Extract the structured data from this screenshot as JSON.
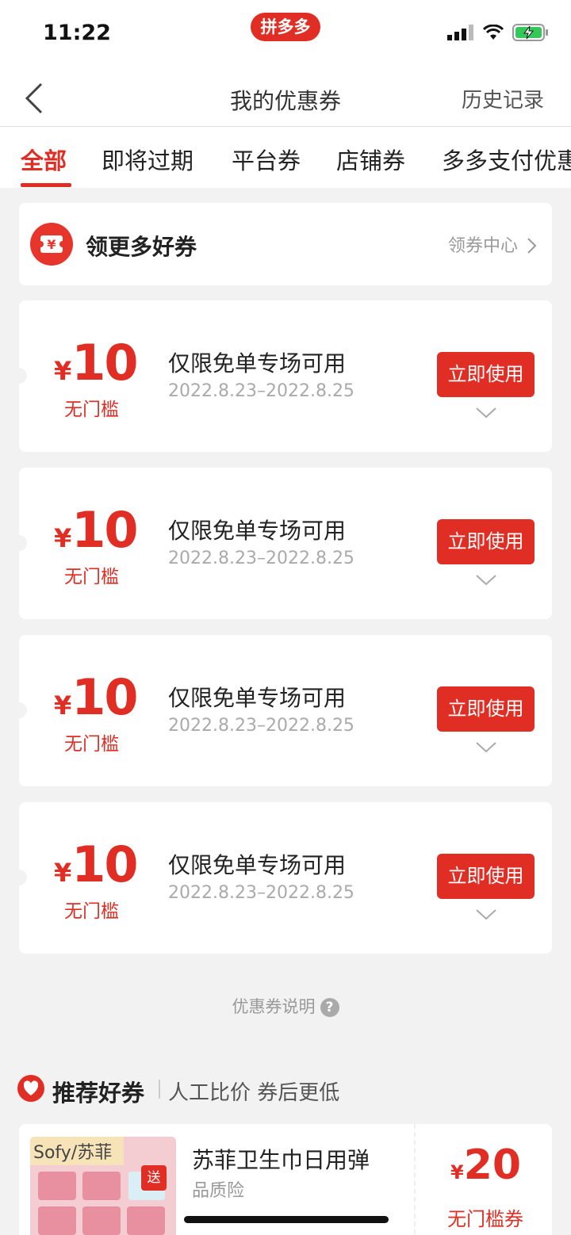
{
  "status": {
    "time": "11:22",
    "app_badge": "拼多多"
  },
  "navbar": {
    "title": "我的优惠券",
    "right_link": "历史记录"
  },
  "tabs": [
    {
      "label": "全部",
      "active": true
    },
    {
      "label": "即将过期",
      "active": false
    },
    {
      "label": "平台券",
      "active": false
    },
    {
      "label": "店铺券",
      "active": false
    },
    {
      "label": "多多支付优惠",
      "active": false
    }
  ],
  "more_coupons": {
    "icon_glyph": "¥",
    "title": "领更多好券",
    "link": "领券中心"
  },
  "coupons": [
    {
      "currency": "¥",
      "amount": "10",
      "threshold": "无门槛",
      "title": "仅限免单专场可用",
      "date": "2022.8.23–2022.8.25",
      "button": "立即使用"
    },
    {
      "currency": "¥",
      "amount": "10",
      "threshold": "无门槛",
      "title": "仅限免单专场可用",
      "date": "2022.8.23–2022.8.25",
      "button": "立即使用"
    },
    {
      "currency": "¥",
      "amount": "10",
      "threshold": "无门槛",
      "title": "仅限免单专场可用",
      "date": "2022.8.23–2022.8.25",
      "button": "立即使用"
    },
    {
      "currency": "¥",
      "amount": "10",
      "threshold": "无门槛",
      "title": "仅限免单专场可用",
      "date": "2022.8.23–2022.8.25",
      "button": "立即使用"
    }
  ],
  "note": {
    "text": "优惠券说明",
    "icon_glyph": "?"
  },
  "recommend": {
    "title": "推荐好券",
    "subtitle": "人工比价 券后更低",
    "item": {
      "brand": "Sofy/苏菲",
      "gift_badge": "送",
      "name": "苏菲卫生巾日用弹",
      "tag": "品质险",
      "currency": "¥",
      "amount": "20",
      "threshold": "无门槛券"
    }
  },
  "colors": {
    "accent": "#e02e24",
    "background": "#f2f2f2"
  }
}
